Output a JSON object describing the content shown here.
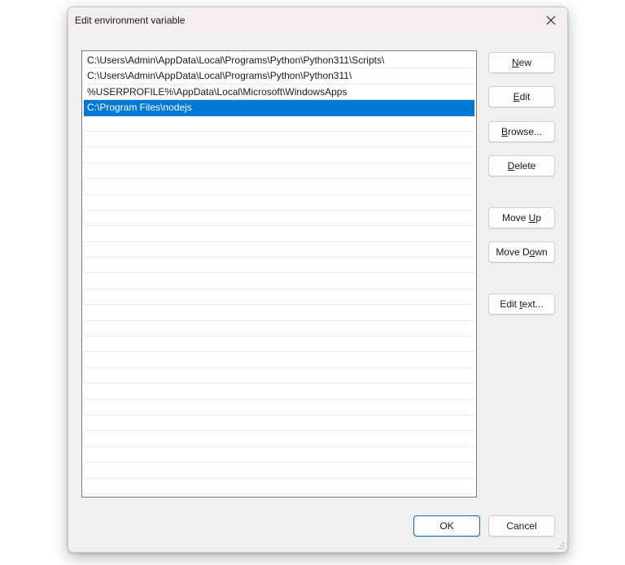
{
  "window": {
    "title": "Edit environment variable"
  },
  "list": {
    "entries": [
      "C:\\Users\\Admin\\AppData\\Local\\Programs\\Python\\Python311\\Scripts\\",
      "C:\\Users\\Admin\\AppData\\Local\\Programs\\Python\\Python311\\",
      "%USERPROFILE%\\AppData\\Local\\Microsoft\\WindowsApps",
      "C:\\Program Files\\nodejs",
      "",
      "",
      "",
      "",
      "",
      "",
      "",
      "",
      "",
      "",
      "",
      "",
      "",
      "",
      "",
      "",
      "",
      "",
      "",
      "",
      "",
      "",
      "",
      ""
    ],
    "selected_index": 3
  },
  "buttons": {
    "new": {
      "pre": "",
      "key": "N",
      "post": "ew"
    },
    "edit": {
      "pre": "",
      "key": "E",
      "post": "dit"
    },
    "browse": {
      "pre": "",
      "key": "B",
      "post": "rowse..."
    },
    "delete": {
      "pre": "",
      "key": "D",
      "post": "elete"
    },
    "move_up": {
      "pre": "Move ",
      "key": "U",
      "post": "p"
    },
    "move_down": {
      "pre": "Move D",
      "key": "o",
      "post": "wn"
    },
    "edit_text": {
      "pre": "Edit ",
      "key": "t",
      "post": "ext..."
    },
    "ok": "OK",
    "cancel": "Cancel"
  },
  "colors": {
    "selection": "#0078d7",
    "dialog_bg": "#f0f0f0",
    "titlebar_bg": "#f5eef1",
    "default_button_border": "#0067c0"
  },
  "icons": {
    "close": "close-icon",
    "resize": "resize-grip-icon"
  }
}
